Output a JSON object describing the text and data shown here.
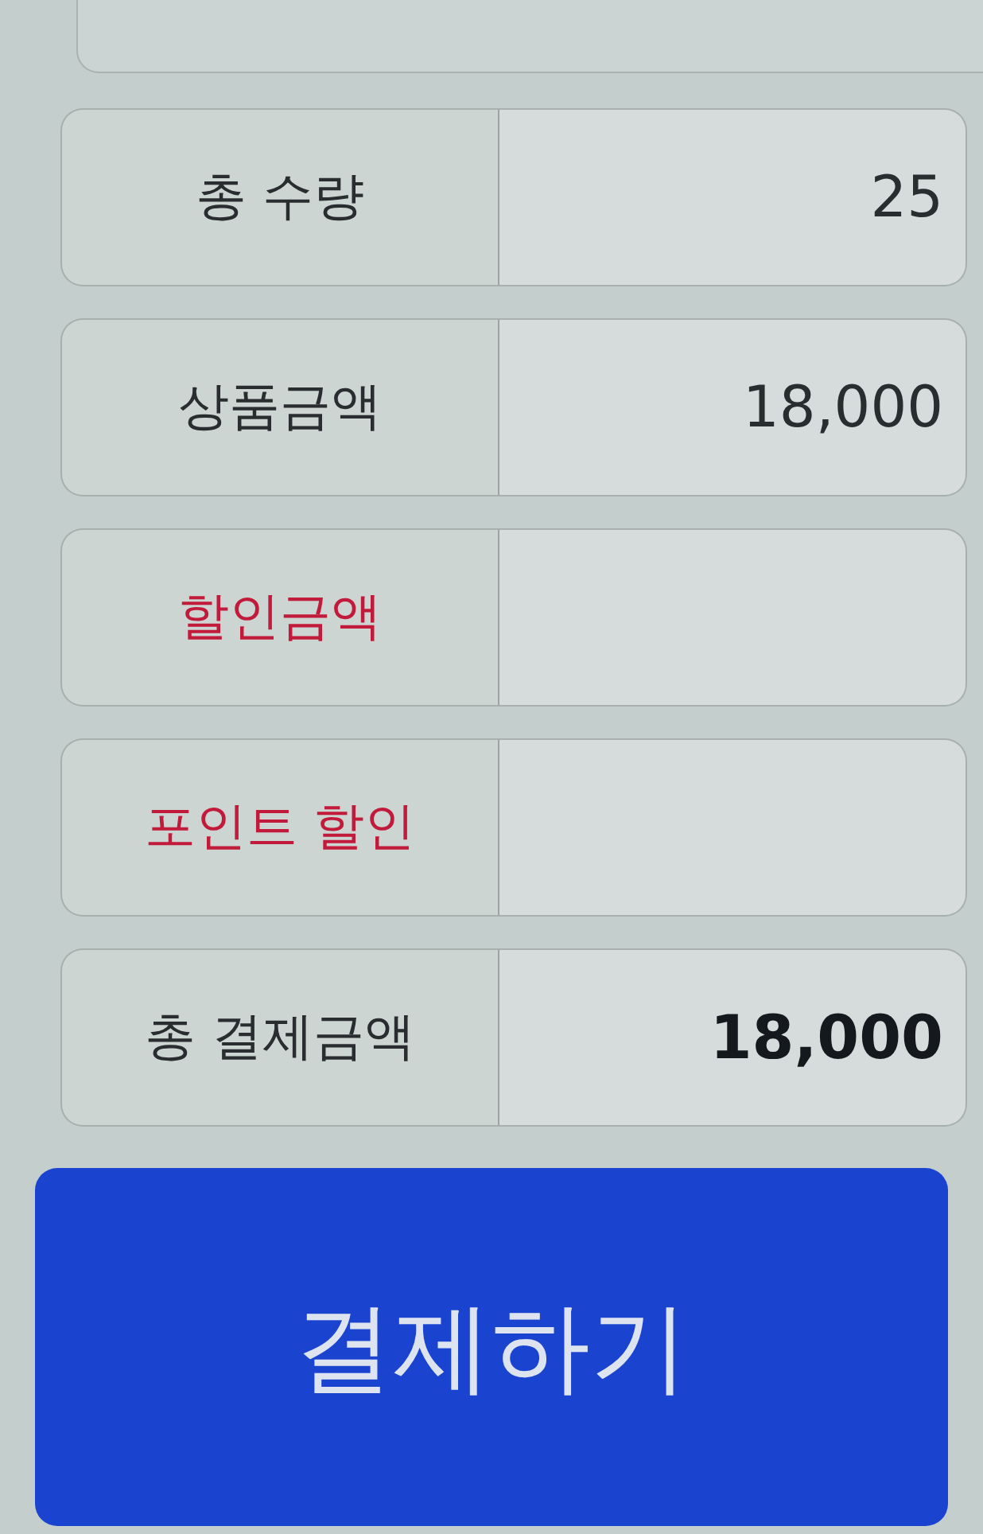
{
  "summary_rows": [
    {
      "kind": "normal",
      "label": "총 수량",
      "value": "25"
    },
    {
      "kind": "normal",
      "label": "상품금액",
      "value": "18,000"
    },
    {
      "kind": "discount",
      "label": "할인금액"
    },
    {
      "kind": "discount",
      "label": "포인트 할인"
    },
    {
      "kind": "total",
      "label": "총 결제금액",
      "value": "18,000"
    }
  ],
  "pay_button": {
    "label": "결제하기"
  }
}
